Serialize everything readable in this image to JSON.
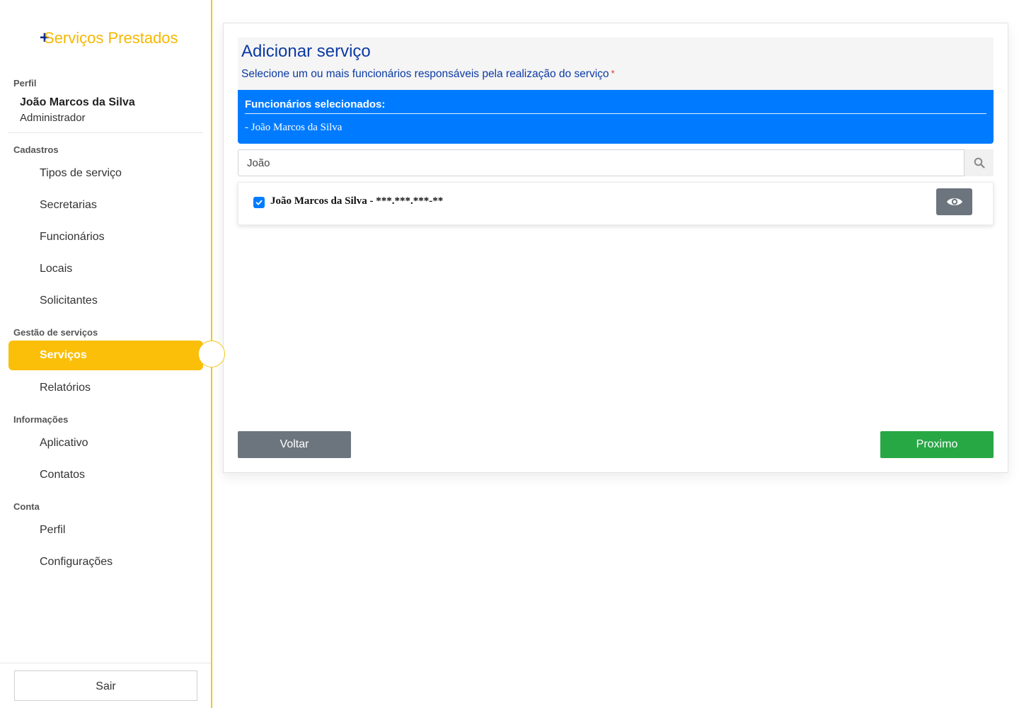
{
  "app": {
    "logo_plus": "+",
    "logo_text": "Serviços Prestados"
  },
  "sidebar": {
    "profile_section": "Perfil",
    "user_name": "João Marcos da Silva",
    "user_role": "Administrador",
    "sections": {
      "cadastros": "Cadastros",
      "gestao": "Gestão de serviços",
      "informacoes": "Informações",
      "conta": "Conta"
    },
    "items": {
      "tipos_servico": "Tipos de serviço",
      "secretarias": "Secretarias",
      "funcionarios": "Funcionários",
      "locais": "Locais",
      "solicitantes": "Solicitantes",
      "servicos": "Serviços",
      "relatorios": "Relatórios",
      "aplicativo": "Aplicativo",
      "contatos": "Contatos",
      "perfil": "Perfil",
      "configuracoes": "Configurações"
    },
    "active_item": "Serviços",
    "logout_label": "Sair"
  },
  "main": {
    "title": "Adicionar serviço",
    "subtitle": "Selecione um ou mais funcionários responsáveis pela realização do serviço",
    "required_mark": "*",
    "selected": {
      "title": "Funcionários selecionados:",
      "items": [
        "- João Marcos da Silva"
      ]
    },
    "search": {
      "value": "João"
    },
    "results": [
      {
        "label": "João Marcos da Silva - ***.***.***-**",
        "checked": true
      }
    ],
    "back_label": "Voltar",
    "next_label": "Proximo"
  },
  "colors": {
    "accent_yellow": "#fbbf09",
    "primary_blue": "#007bff",
    "title_blue": "#0b3aa4",
    "success_green": "#28a745",
    "secondary_gray": "#6c757d"
  }
}
